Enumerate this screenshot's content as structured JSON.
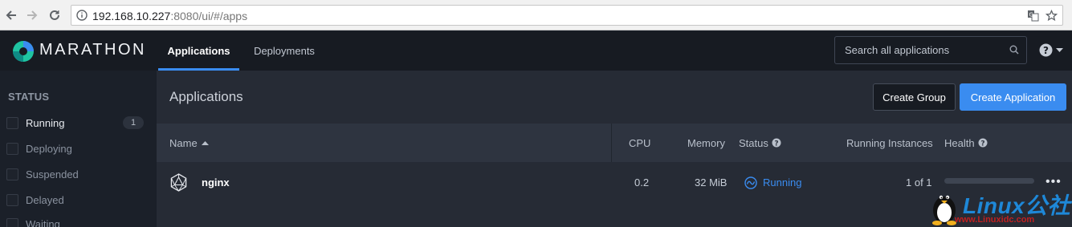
{
  "browser": {
    "url_host": "192.168.10.227",
    "url_rest": ":8080/ui/#/apps"
  },
  "header": {
    "brand": "MARATHON",
    "tabs": [
      {
        "label": "Applications",
        "active": true
      },
      {
        "label": "Deployments",
        "active": false
      }
    ],
    "search_placeholder": "Search all applications"
  },
  "sidebar": {
    "heading": "STATUS",
    "items": [
      {
        "label": "Running",
        "count": "1",
        "active": true
      },
      {
        "label": "Deploying"
      },
      {
        "label": "Suspended"
      },
      {
        "label": "Delayed"
      },
      {
        "label": "Waiting"
      }
    ]
  },
  "main": {
    "title": "Applications",
    "create_group_label": "Create Group",
    "create_app_label": "Create Application",
    "columns": {
      "name": "Name",
      "cpu": "CPU",
      "memory": "Memory",
      "status": "Status",
      "running_instances": "Running Instances",
      "health": "Health"
    },
    "rows": [
      {
        "name": "nginx",
        "cpu": "0.2",
        "memory": "32 MiB",
        "status": "Running",
        "instances": "1 of 1",
        "health_fraction": 0
      }
    ]
  },
  "watermark": {
    "title": "Linux公社",
    "site": "www.Linuxidc.com"
  },
  "colors": {
    "accent": "#3a8cf0",
    "header_bg": "#171b22",
    "sidebar_bg": "#1b2029",
    "main_bg": "#262b35",
    "table_header_bg": "#2e3440"
  }
}
